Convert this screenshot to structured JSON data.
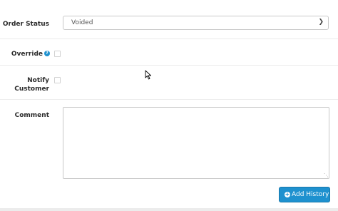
{
  "order_status": {
    "label": "Order Status",
    "selected": "Voided"
  },
  "override": {
    "label": "Override",
    "checked": false
  },
  "notify": {
    "label_line1": "Notify",
    "label_line2": "Customer",
    "checked": false
  },
  "comment": {
    "label": "Comment",
    "value": ""
  },
  "add_history_button": {
    "label": "Add History"
  },
  "icons": {
    "help": "question-circle-icon",
    "button": "plus-circle-icon",
    "select": "chevron-down-icon",
    "cursor": "mouse-cursor-icon"
  },
  "colors": {
    "accent": "#1e91cf"
  }
}
